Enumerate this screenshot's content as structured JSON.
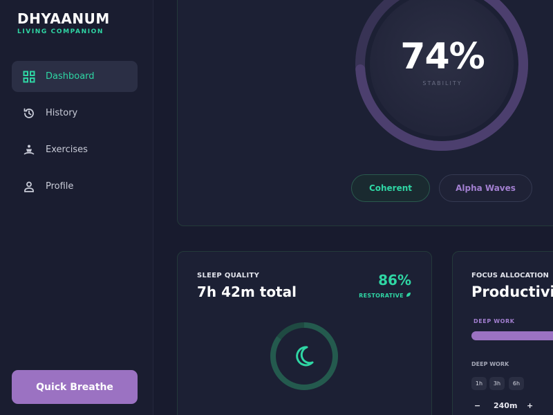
{
  "brand": {
    "name": "DHYAANUM",
    "subtitle": "LIVING COMPANION"
  },
  "sidebar": {
    "items": [
      {
        "label": "Dashboard",
        "icon": "grid-icon",
        "active": true
      },
      {
        "label": "History",
        "icon": "history-icon",
        "active": false
      },
      {
        "label": "Exercises",
        "icon": "meditation-icon",
        "active": false
      },
      {
        "label": "Profile",
        "icon": "person-icon",
        "active": false
      }
    ],
    "quick_label": "Quick Breathe"
  },
  "stability": {
    "value": "74%",
    "level": 0.74,
    "label": "STABILITY"
  },
  "tags": {
    "coherent": "Coherent",
    "alpha": "Alpha Waves"
  },
  "sleep": {
    "title": "SLEEP QUALITY",
    "total": "7h 42m total",
    "score": "86%",
    "score_label": "RESTORATIVE",
    "icon": "moon-icon"
  },
  "focus": {
    "title": "FOCUS ALLOCATION",
    "main": "Productivity",
    "deep_label": "DEEP WORK",
    "deep_label2": "DEEP WORK",
    "chips": [
      "1h",
      "3h",
      "6h"
    ],
    "minus": "−",
    "value": "240m",
    "plus": "+"
  },
  "colors": {
    "accent_green": "#2fd6a4",
    "accent_purple": "#9b72c2",
    "background": "#181b2e"
  }
}
